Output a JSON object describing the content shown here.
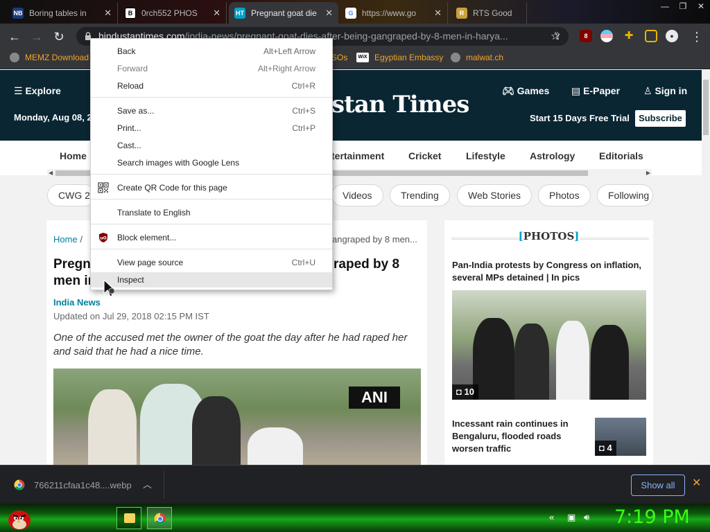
{
  "browser": {
    "tabs": [
      {
        "title": "Boring tables in",
        "favicon": "NB"
      },
      {
        "title": "0rch552 PHOS",
        "favicon": "B"
      },
      {
        "title": "Pregnant goat die",
        "favicon": "HT",
        "active": true
      },
      {
        "title": "https://www.go",
        "favicon": "G"
      },
      {
        "title": "RTS Good",
        "favicon": "R"
      }
    ],
    "url_host": "hindustantimes.com",
    "url_path": "/india-news/pregnant-goat-dies-after-being-gangraped-by-8-men-in-harya...",
    "extension_badge": "8",
    "bookmarks": [
      "MEMZ Download",
      "SOs",
      "Egyptian Embassy",
      "malwat.ch"
    ],
    "bookmark_wix_label": "WiX"
  },
  "site": {
    "explore": "Explore",
    "date": "Monday, Aug 08, 2",
    "logo": "stan Times",
    "games": "Games",
    "epaper": "E-Paper",
    "signin": "Sign in",
    "trial": "Start 15 Days Free Trial",
    "subscribe": "Subscribe",
    "nav": [
      "Home",
      "tertainment",
      "Cricket",
      "Lifestyle",
      "Astrology",
      "Editorials"
    ],
    "chips": [
      "CWG 20",
      "Videos",
      "Trending",
      "Web Stories",
      "Photos",
      "Following"
    ]
  },
  "article": {
    "crumb_home": "Home",
    "crumb_sep": "/",
    "crumb_tail": "angraped by 8 men...",
    "headline_a": "Pregn",
    "headline_b": "men in",
    "headline_c": "raped by 8",
    "section": "India News",
    "updated": "Updated on Jul 29, 2018 02:15 PM IST",
    "summary": "One of the accused met the owner of the goat the day after he had raped her and said that he had a nice time.",
    "image_watermark": "ANI"
  },
  "sidebar": {
    "photos_title": "PHOTOS",
    "story1": "Pan-India protests by Congress on inflation, several MPs detained | In pics",
    "story1_count": "10",
    "story2": "Incessant rain continues in Bengaluru, flooded roads worsen traffic",
    "story2_count": "4"
  },
  "context_menu": {
    "items": [
      {
        "label": "Back",
        "shortcut": "Alt+Left Arrow"
      },
      {
        "label": "Forward",
        "shortcut": "Alt+Right Arrow"
      },
      {
        "label": "Reload",
        "shortcut": "Ctrl+R"
      },
      {
        "label": "Save as...",
        "shortcut": "Ctrl+S"
      },
      {
        "label": "Print...",
        "shortcut": "Ctrl+P"
      },
      {
        "label": "Cast...",
        "shortcut": ""
      },
      {
        "label": "Search images with Google Lens",
        "shortcut": ""
      },
      {
        "label": "Create QR Code for this page",
        "shortcut": ""
      },
      {
        "label": "Translate to English",
        "shortcut": ""
      },
      {
        "label": "Block element...",
        "shortcut": ""
      },
      {
        "label": "View page source",
        "shortcut": "Ctrl+U"
      },
      {
        "label": "Inspect",
        "shortcut": ""
      }
    ],
    "ublock_icon_text": "uO"
  },
  "download_bar": {
    "filename": "766211cfaa1c48....webp",
    "show_all": "Show all"
  },
  "taskbar": {
    "clock": "7:19 PM"
  },
  "colors": {
    "ht_header": "#0a2633",
    "link_teal": "#00809d",
    "bookmark_orange": "#f5a623",
    "clock_green": "#39ff14"
  }
}
